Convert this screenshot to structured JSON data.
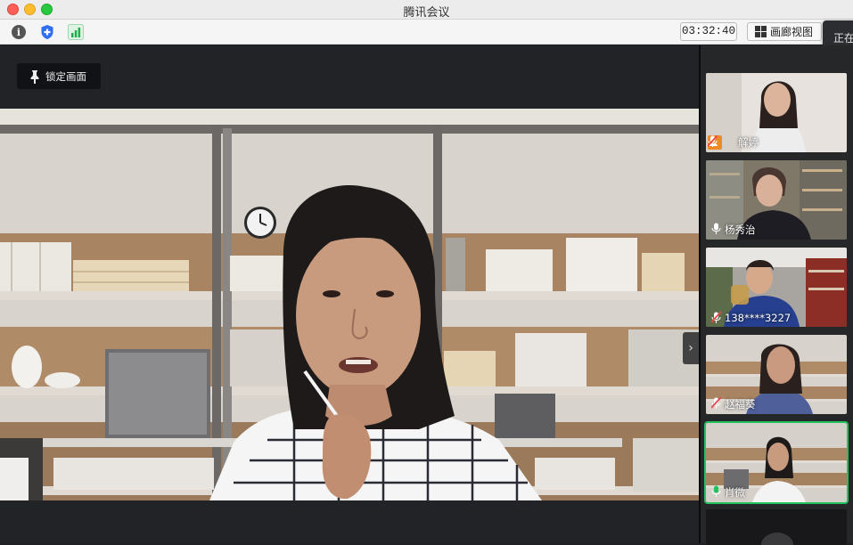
{
  "window": {
    "title": "腾讯会议"
  },
  "toolbar": {
    "icons": [
      "info-icon",
      "shield-icon",
      "signal-icon"
    ],
    "timer": "03:32:40",
    "gallery_view_label": "画廊视图",
    "tooltip_partial": "正在"
  },
  "main": {
    "lock_screen_label": "锁定画面",
    "next_page_arrow": "›"
  },
  "participants": [
    {
      "name": "解婷",
      "muted": true,
      "host": true,
      "speaking": false
    },
    {
      "name": "杨秀治",
      "muted": false,
      "host": false,
      "speaking": false
    },
    {
      "name": "138****3227",
      "muted": true,
      "host": false,
      "speaking": false
    },
    {
      "name": "赵福葵",
      "muted": true,
      "host": false,
      "speaking": false
    },
    {
      "name": "肖微",
      "muted": false,
      "host": false,
      "speaking": true
    }
  ],
  "colors": {
    "speaking_outline": "#22c15e",
    "muted_mic": "#e5484d",
    "host_badge": "#f08a24",
    "background": "#222327"
  }
}
